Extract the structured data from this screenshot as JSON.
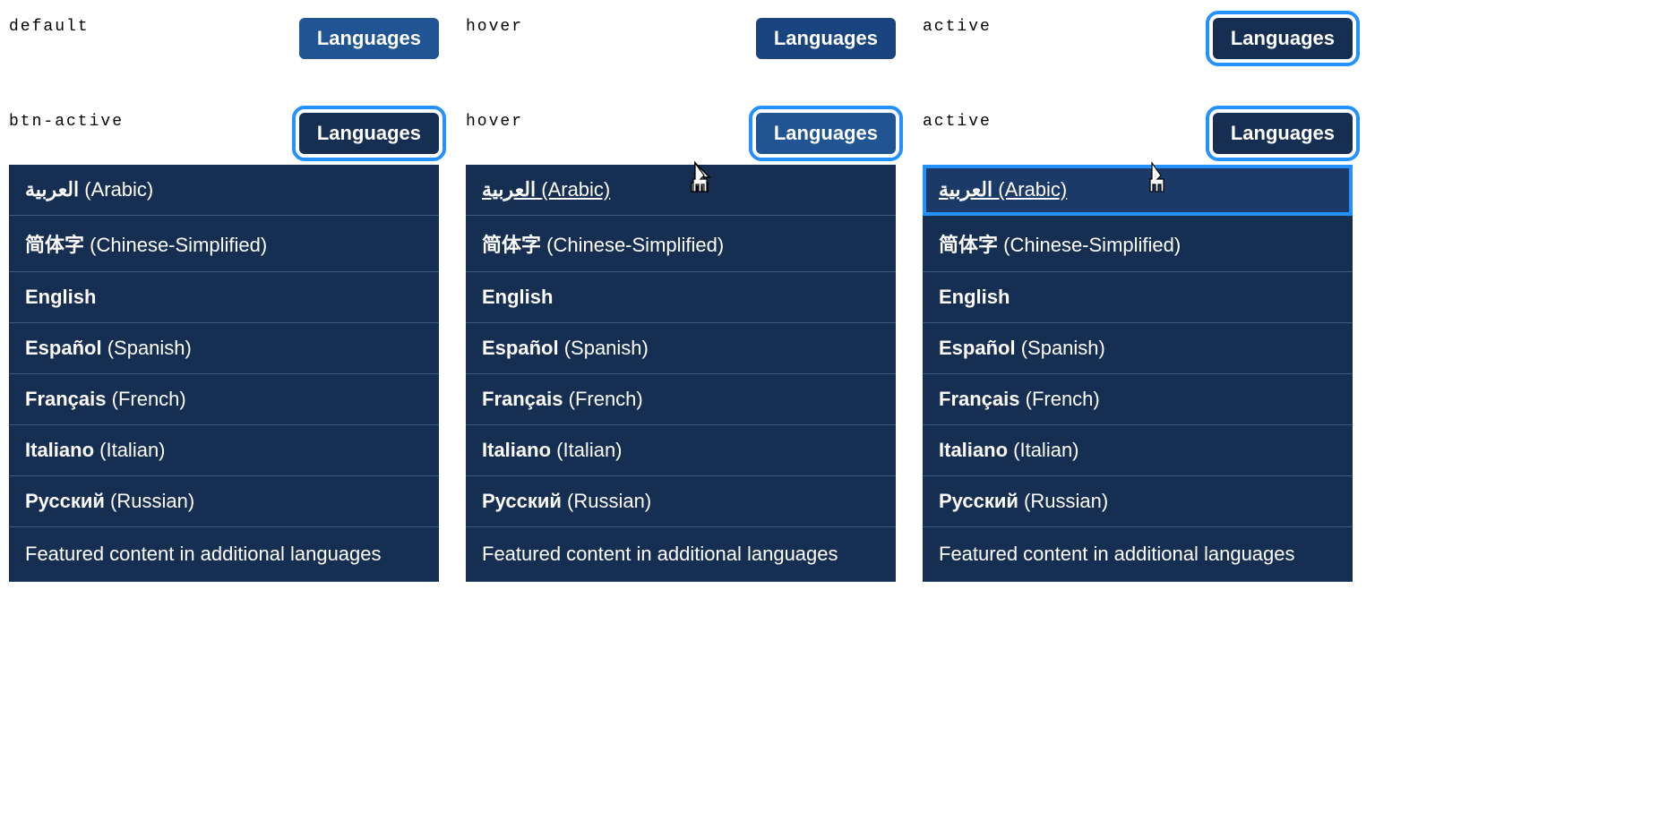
{
  "states": {
    "row1": [
      {
        "label": "default",
        "variant": "default"
      },
      {
        "label": "hover",
        "variant": "hover"
      },
      {
        "label": "active",
        "variant": "active"
      }
    ],
    "row2": [
      {
        "label": "btn-active",
        "variant": "btn-active-default",
        "item_state": "none"
      },
      {
        "label": "hover",
        "variant": "btn-active-hover",
        "item_state": "hovered"
      },
      {
        "label": "active",
        "variant": "btn-active-active",
        "item_state": "active"
      }
    ]
  },
  "button_label": "Languages",
  "dropdown": {
    "items": [
      {
        "native": "العربية",
        "english": "(Arabic)"
      },
      {
        "native": "简体字",
        "english": "(Chinese-Simplified)"
      },
      {
        "native": "English",
        "english": ""
      },
      {
        "native": "Español",
        "english": "(Spanish)"
      },
      {
        "native": "Français",
        "english": "(French)"
      },
      {
        "native": "Italiano",
        "english": "(Italian)"
      },
      {
        "native": "Русский",
        "english": "(Russian)"
      }
    ],
    "featured_label": "Featured content in additional languages"
  }
}
